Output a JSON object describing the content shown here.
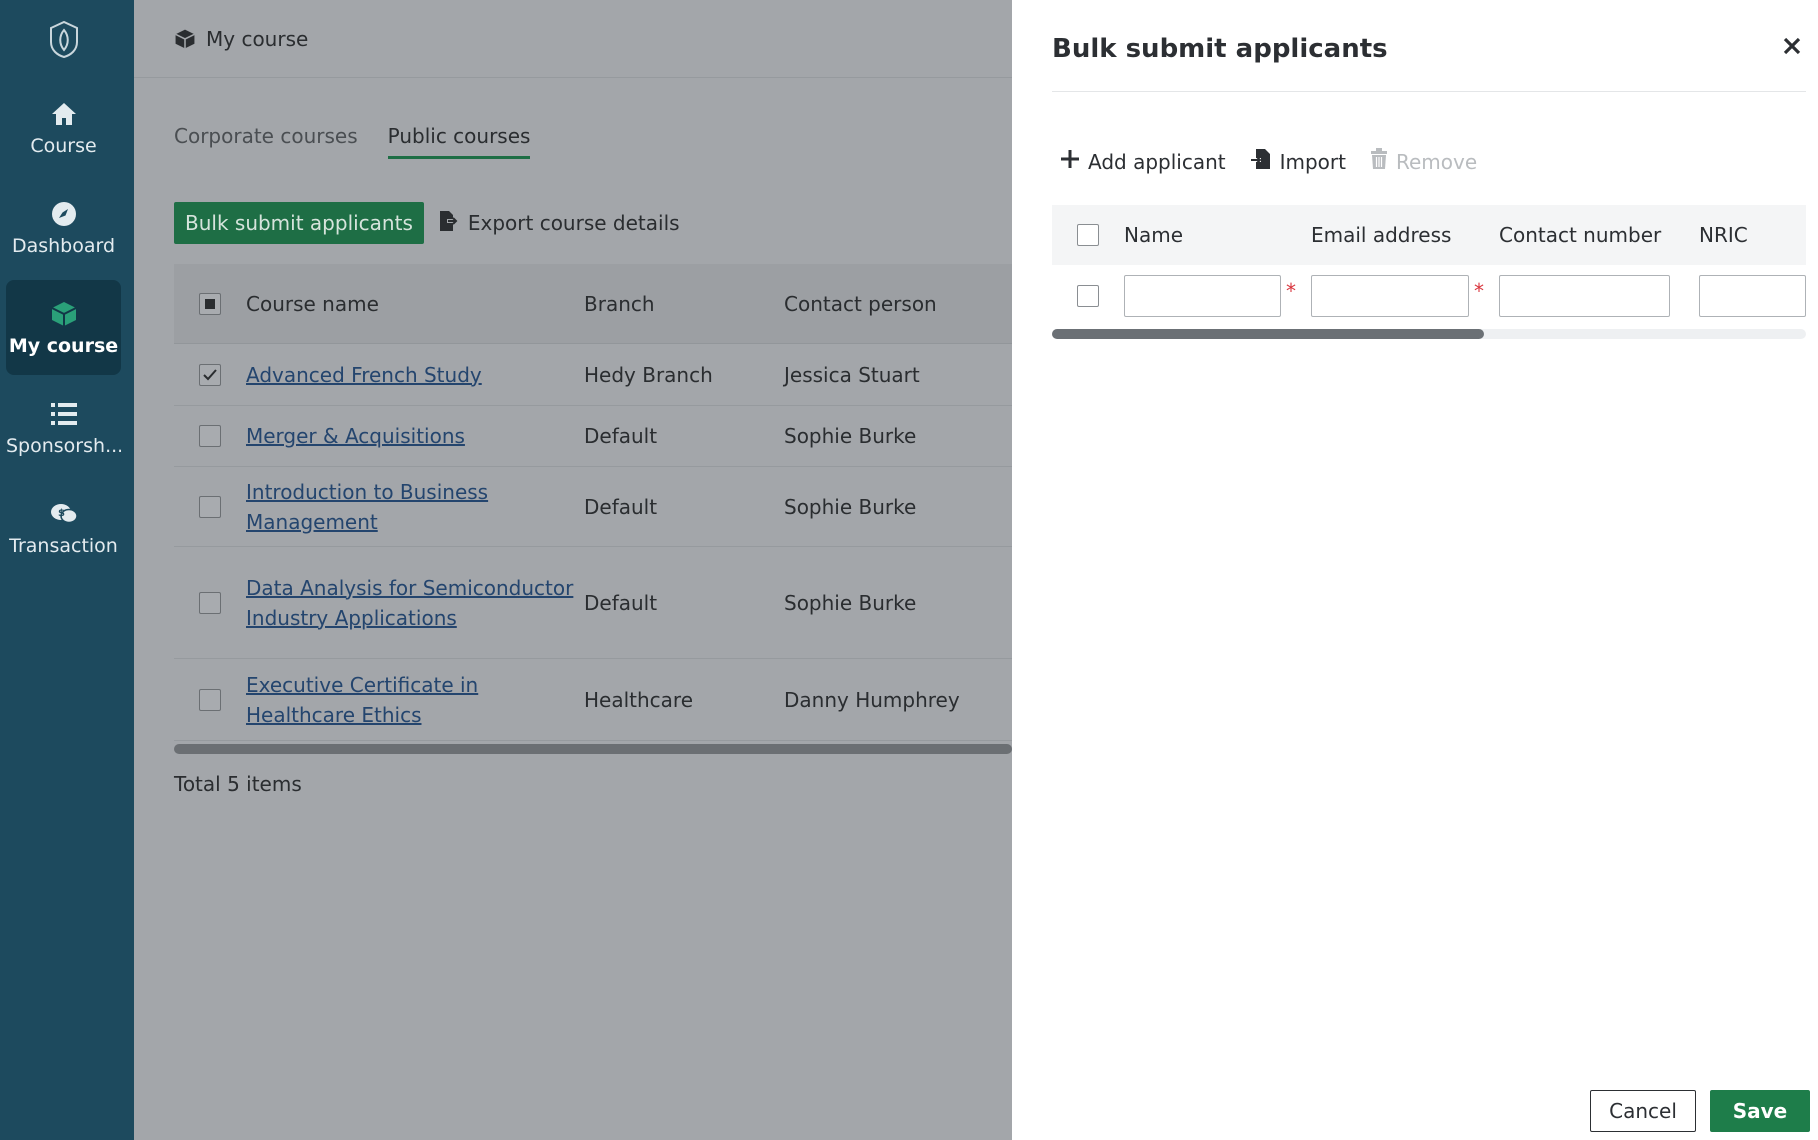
{
  "sidebar": {
    "items": [
      {
        "label": "Course",
        "icon": "home-icon"
      },
      {
        "label": "Dashboard",
        "icon": "compass-icon"
      },
      {
        "label": "My course",
        "icon": "box-icon"
      },
      {
        "label": "Sponsorsh...",
        "icon": "list-icon"
      },
      {
        "label": "Transaction",
        "icon": "chat-money-icon"
      }
    ]
  },
  "header": {
    "title": "My course"
  },
  "tabs": [
    {
      "label": "Corporate courses"
    },
    {
      "label": "Public courses"
    }
  ],
  "actions": {
    "bulk_label": "Bulk submit applicants",
    "export_label": "Export course details"
  },
  "table": {
    "columns": [
      "Course name",
      "Branch",
      "Contact person"
    ],
    "rows": [
      {
        "course": "Advanced French Study",
        "branch": "Hedy Branch",
        "contact": "Jessica Stuart"
      },
      {
        "course": "Merger & Acquisitions",
        "branch": "Default",
        "contact": "Sophie Burke"
      },
      {
        "course": "Introduction to Business Management",
        "branch": "Default",
        "contact": "Sophie Burke"
      },
      {
        "course": "Data Analysis for Semiconductor Industry Applications",
        "branch": "Default",
        "contact": "Sophie Burke"
      },
      {
        "course": "Executive Certificate in Healthcare Ethics",
        "branch": "Healthcare",
        "contact": "Danny Humphrey"
      }
    ],
    "total": "Total 5 items"
  },
  "drawer": {
    "title": "Bulk submit applicants",
    "toolbar": {
      "add": "Add applicant",
      "import": "Import",
      "remove": "Remove"
    },
    "columns": [
      "Name",
      "Email address",
      "Contact number",
      "NRIC"
    ],
    "required_mark": "*",
    "cancel": "Cancel",
    "save": "Save"
  },
  "colors": {
    "sidebar": "#1d4a5e",
    "primary": "#1e7d4a",
    "required": "#d9363e"
  }
}
